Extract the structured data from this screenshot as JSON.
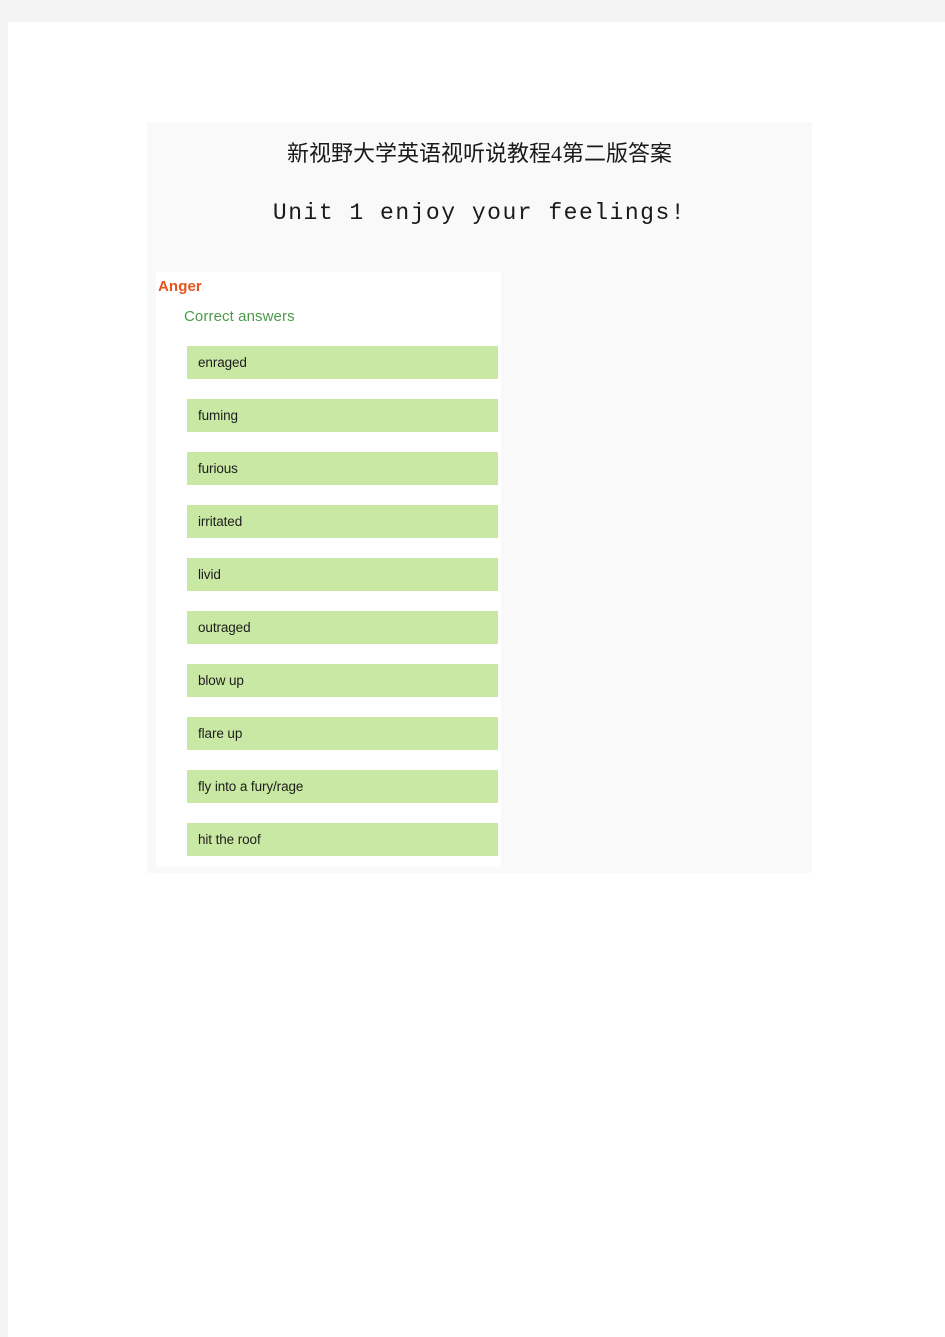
{
  "document": {
    "title": "新视野大学英语视听说教程4第二版答案",
    "subtitle": "Unit 1 enjoy your feelings!"
  },
  "answer_panel": {
    "category": "Anger",
    "category_color": "#e8541c",
    "correct_answers_label": "Correct answers",
    "correct_answers_label_color": "#4b9a4b",
    "answer_box_color": "#c9e8a3",
    "answers": [
      "enraged",
      "fuming",
      "furious",
      "irritated",
      "livid",
      "outraged",
      "blow up",
      "flare up",
      "fly into a fury/rage",
      "hit the roof"
    ]
  },
  "colors": {
    "page_background": "#ffffff",
    "outer_background": "#f4f4f4",
    "screenshot_background": "#f9f9f9"
  }
}
